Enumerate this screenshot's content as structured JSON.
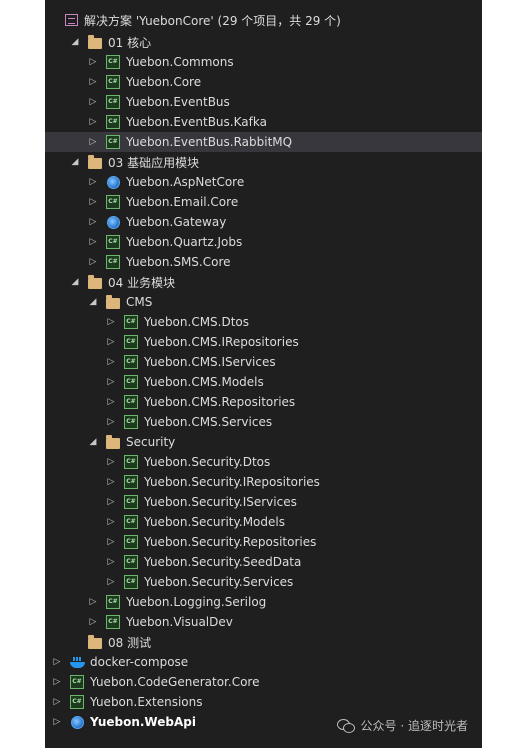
{
  "solution": {
    "label": "解决方案 'YuebonCore' (29 个项目，共 29 个)"
  },
  "tree": [
    {
      "label": "01 核心",
      "type": "folder",
      "depth": 0,
      "expanded": true
    },
    {
      "label": "Yuebon.Commons",
      "type": "csproj",
      "depth": 1
    },
    {
      "label": "Yuebon.Core",
      "type": "csproj",
      "depth": 1
    },
    {
      "label": "Yuebon.EventBus",
      "type": "csproj",
      "depth": 1
    },
    {
      "label": "Yuebon.EventBus.Kafka",
      "type": "csproj",
      "depth": 1
    },
    {
      "label": "Yuebon.EventBus.RabbitMQ",
      "type": "csproj",
      "depth": 1,
      "selected": true
    },
    {
      "label": "03 基础应用模块",
      "type": "folder",
      "depth": 0,
      "expanded": true
    },
    {
      "label": "Yuebon.AspNetCore",
      "type": "web",
      "depth": 1
    },
    {
      "label": "Yuebon.Email.Core",
      "type": "csproj",
      "depth": 1
    },
    {
      "label": "Yuebon.Gateway",
      "type": "web",
      "depth": 1
    },
    {
      "label": "Yuebon.Quartz.Jobs",
      "type": "csproj",
      "depth": 1
    },
    {
      "label": "Yuebon.SMS.Core",
      "type": "csproj",
      "depth": 1
    },
    {
      "label": "04 业务模块",
      "type": "folder",
      "depth": 0,
      "expanded": true
    },
    {
      "label": "CMS",
      "type": "folder",
      "depth": 1,
      "expanded": true
    },
    {
      "label": "Yuebon.CMS.Dtos",
      "type": "csproj",
      "depth": 2
    },
    {
      "label": "Yuebon.CMS.IRepositories",
      "type": "csproj",
      "depth": 2
    },
    {
      "label": "Yuebon.CMS.IServices",
      "type": "csproj",
      "depth": 2
    },
    {
      "label": "Yuebon.CMS.Models",
      "type": "csproj",
      "depth": 2
    },
    {
      "label": "Yuebon.CMS.Repositories",
      "type": "csproj",
      "depth": 2
    },
    {
      "label": "Yuebon.CMS.Services",
      "type": "csproj",
      "depth": 2
    },
    {
      "label": "Security",
      "type": "folder",
      "depth": 1,
      "expanded": true
    },
    {
      "label": "Yuebon.Security.Dtos",
      "type": "csproj",
      "depth": 2
    },
    {
      "label": "Yuebon.Security.IRepositories",
      "type": "csproj",
      "depth": 2
    },
    {
      "label": "Yuebon.Security.IServices",
      "type": "csproj",
      "depth": 2
    },
    {
      "label": "Yuebon.Security.Models",
      "type": "csproj",
      "depth": 2
    },
    {
      "label": "Yuebon.Security.Repositories",
      "type": "csproj",
      "depth": 2
    },
    {
      "label": "Yuebon.Security.SeedData",
      "type": "csproj",
      "depth": 2
    },
    {
      "label": "Yuebon.Security.Services",
      "type": "csproj",
      "depth": 2
    },
    {
      "label": "Yuebon.Logging.Serilog",
      "type": "csproj",
      "depth": 1
    },
    {
      "label": "Yuebon.VisualDev",
      "type": "csproj",
      "depth": 1
    },
    {
      "label": "08 测试",
      "type": "folder",
      "depth": 0,
      "noArrow": true
    },
    {
      "label": "docker-compose",
      "type": "docker",
      "depth": -1
    },
    {
      "label": "Yuebon.CodeGenerator.Core",
      "type": "csproj",
      "depth": -1
    },
    {
      "label": "Yuebon.Extensions",
      "type": "csproj",
      "depth": -1
    },
    {
      "label": "Yuebon.WebApi",
      "type": "web",
      "depth": -1,
      "bold": true
    }
  ],
  "icons": {
    "cs_glyph": "C#",
    "collapsed_glyph": "▷",
    "expanded_glyph": "◢"
  },
  "colors": {
    "panel_bg": "#1f1f1f",
    "text": "#dcdcdc",
    "folder": "#dcb67a",
    "selected_bg": "#37373d"
  },
  "watermark": {
    "text": "公众号 · 追逐时光者"
  }
}
